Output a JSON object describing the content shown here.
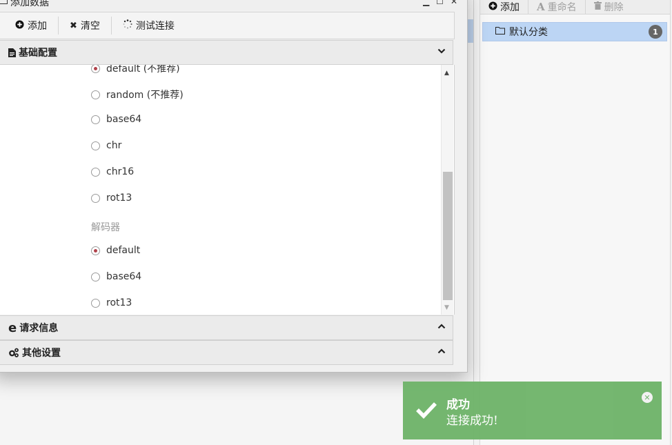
{
  "dialog": {
    "title": "添加数据",
    "toolbar": {
      "add_label": "添加",
      "clear_label": "清空",
      "test_label": "测试连接"
    },
    "sections": {
      "basic": "基础配置",
      "request": "请求信息",
      "other": "其他设置"
    },
    "encoders": [
      {
        "label": "default (不推荐)",
        "checked": true
      },
      {
        "label": "random (不推荐)",
        "checked": false
      },
      {
        "label": "base64",
        "checked": false
      },
      {
        "label": "chr",
        "checked": false
      },
      {
        "label": "chr16",
        "checked": false
      },
      {
        "label": "rot13",
        "checked": false
      }
    ],
    "decoder_label": "解码器",
    "decoders": [
      {
        "label": "default",
        "checked": true
      },
      {
        "label": "base64",
        "checked": false
      },
      {
        "label": "rot13",
        "checked": false
      }
    ]
  },
  "category_panel": {
    "toolbar": {
      "add_label": "添加",
      "rename_label": "重命名",
      "delete_label": "删除"
    },
    "items": [
      {
        "label": "默认分类",
        "count": "1"
      }
    ]
  },
  "toast": {
    "title": "成功",
    "message": "连接成功!",
    "color": "#6fb46a"
  }
}
